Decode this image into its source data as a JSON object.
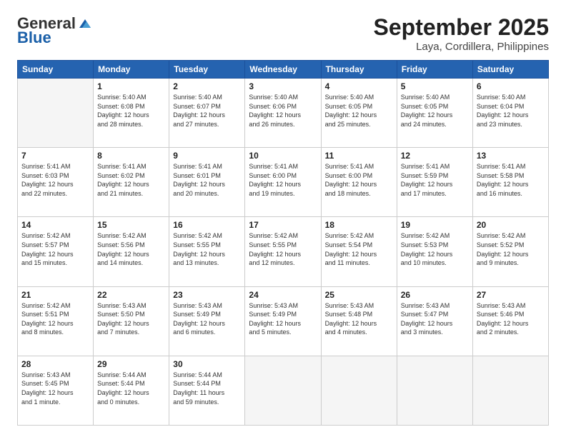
{
  "header": {
    "logo_general": "General",
    "logo_blue": "Blue",
    "title": "September 2025",
    "subtitle": "Laya, Cordillera, Philippines"
  },
  "days_of_week": [
    "Sunday",
    "Monday",
    "Tuesday",
    "Wednesday",
    "Thursday",
    "Friday",
    "Saturday"
  ],
  "weeks": [
    [
      {
        "day": "",
        "info": ""
      },
      {
        "day": "1",
        "info": "Sunrise: 5:40 AM\nSunset: 6:08 PM\nDaylight: 12 hours\nand 28 minutes."
      },
      {
        "day": "2",
        "info": "Sunrise: 5:40 AM\nSunset: 6:07 PM\nDaylight: 12 hours\nand 27 minutes."
      },
      {
        "day": "3",
        "info": "Sunrise: 5:40 AM\nSunset: 6:06 PM\nDaylight: 12 hours\nand 26 minutes."
      },
      {
        "day": "4",
        "info": "Sunrise: 5:40 AM\nSunset: 6:05 PM\nDaylight: 12 hours\nand 25 minutes."
      },
      {
        "day": "5",
        "info": "Sunrise: 5:40 AM\nSunset: 6:05 PM\nDaylight: 12 hours\nand 24 minutes."
      },
      {
        "day": "6",
        "info": "Sunrise: 5:40 AM\nSunset: 6:04 PM\nDaylight: 12 hours\nand 23 minutes."
      }
    ],
    [
      {
        "day": "7",
        "info": "Sunrise: 5:41 AM\nSunset: 6:03 PM\nDaylight: 12 hours\nand 22 minutes."
      },
      {
        "day": "8",
        "info": "Sunrise: 5:41 AM\nSunset: 6:02 PM\nDaylight: 12 hours\nand 21 minutes."
      },
      {
        "day": "9",
        "info": "Sunrise: 5:41 AM\nSunset: 6:01 PM\nDaylight: 12 hours\nand 20 minutes."
      },
      {
        "day": "10",
        "info": "Sunrise: 5:41 AM\nSunset: 6:00 PM\nDaylight: 12 hours\nand 19 minutes."
      },
      {
        "day": "11",
        "info": "Sunrise: 5:41 AM\nSunset: 6:00 PM\nDaylight: 12 hours\nand 18 minutes."
      },
      {
        "day": "12",
        "info": "Sunrise: 5:41 AM\nSunset: 5:59 PM\nDaylight: 12 hours\nand 17 minutes."
      },
      {
        "day": "13",
        "info": "Sunrise: 5:41 AM\nSunset: 5:58 PM\nDaylight: 12 hours\nand 16 minutes."
      }
    ],
    [
      {
        "day": "14",
        "info": "Sunrise: 5:42 AM\nSunset: 5:57 PM\nDaylight: 12 hours\nand 15 minutes."
      },
      {
        "day": "15",
        "info": "Sunrise: 5:42 AM\nSunset: 5:56 PM\nDaylight: 12 hours\nand 14 minutes."
      },
      {
        "day": "16",
        "info": "Sunrise: 5:42 AM\nSunset: 5:55 PM\nDaylight: 12 hours\nand 13 minutes."
      },
      {
        "day": "17",
        "info": "Sunrise: 5:42 AM\nSunset: 5:55 PM\nDaylight: 12 hours\nand 12 minutes."
      },
      {
        "day": "18",
        "info": "Sunrise: 5:42 AM\nSunset: 5:54 PM\nDaylight: 12 hours\nand 11 minutes."
      },
      {
        "day": "19",
        "info": "Sunrise: 5:42 AM\nSunset: 5:53 PM\nDaylight: 12 hours\nand 10 minutes."
      },
      {
        "day": "20",
        "info": "Sunrise: 5:42 AM\nSunset: 5:52 PM\nDaylight: 12 hours\nand 9 minutes."
      }
    ],
    [
      {
        "day": "21",
        "info": "Sunrise: 5:42 AM\nSunset: 5:51 PM\nDaylight: 12 hours\nand 8 minutes."
      },
      {
        "day": "22",
        "info": "Sunrise: 5:43 AM\nSunset: 5:50 PM\nDaylight: 12 hours\nand 7 minutes."
      },
      {
        "day": "23",
        "info": "Sunrise: 5:43 AM\nSunset: 5:49 PM\nDaylight: 12 hours\nand 6 minutes."
      },
      {
        "day": "24",
        "info": "Sunrise: 5:43 AM\nSunset: 5:49 PM\nDaylight: 12 hours\nand 5 minutes."
      },
      {
        "day": "25",
        "info": "Sunrise: 5:43 AM\nSunset: 5:48 PM\nDaylight: 12 hours\nand 4 minutes."
      },
      {
        "day": "26",
        "info": "Sunrise: 5:43 AM\nSunset: 5:47 PM\nDaylight: 12 hours\nand 3 minutes."
      },
      {
        "day": "27",
        "info": "Sunrise: 5:43 AM\nSunset: 5:46 PM\nDaylight: 12 hours\nand 2 minutes."
      }
    ],
    [
      {
        "day": "28",
        "info": "Sunrise: 5:43 AM\nSunset: 5:45 PM\nDaylight: 12 hours\nand 1 minute."
      },
      {
        "day": "29",
        "info": "Sunrise: 5:44 AM\nSunset: 5:44 PM\nDaylight: 12 hours\nand 0 minutes."
      },
      {
        "day": "30",
        "info": "Sunrise: 5:44 AM\nSunset: 5:44 PM\nDaylight: 11 hours\nand 59 minutes."
      },
      {
        "day": "",
        "info": ""
      },
      {
        "day": "",
        "info": ""
      },
      {
        "day": "",
        "info": ""
      },
      {
        "day": "",
        "info": ""
      }
    ]
  ]
}
